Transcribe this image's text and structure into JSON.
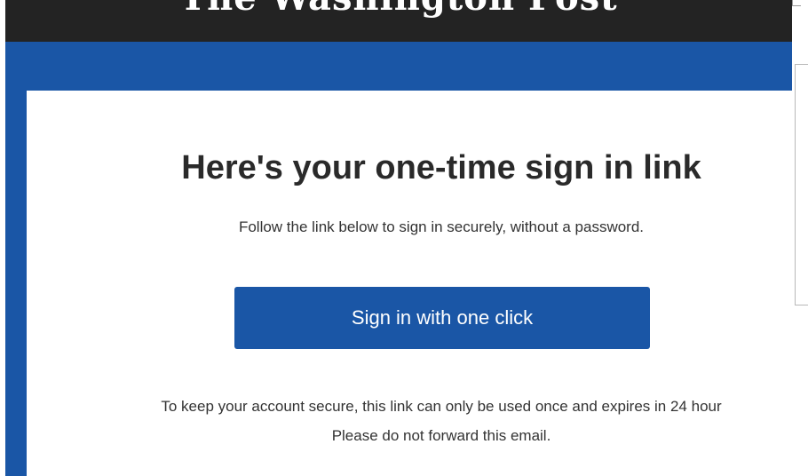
{
  "email": {
    "masthead_logo": "The Washington Post",
    "headline": "Here's your one-time sign in link",
    "subline": "Follow the link below to sign in securely, without a password.",
    "button_label": "Sign in with one click",
    "footnote_line1": "To keep your account secure, this link can only be used once and expires in 24 hour",
    "footnote_line2": "Please do not forward this email."
  },
  "colors": {
    "masthead_bg": "#232323",
    "brand_blue": "#1a56a6",
    "text_dark": "#2a2a2a"
  }
}
